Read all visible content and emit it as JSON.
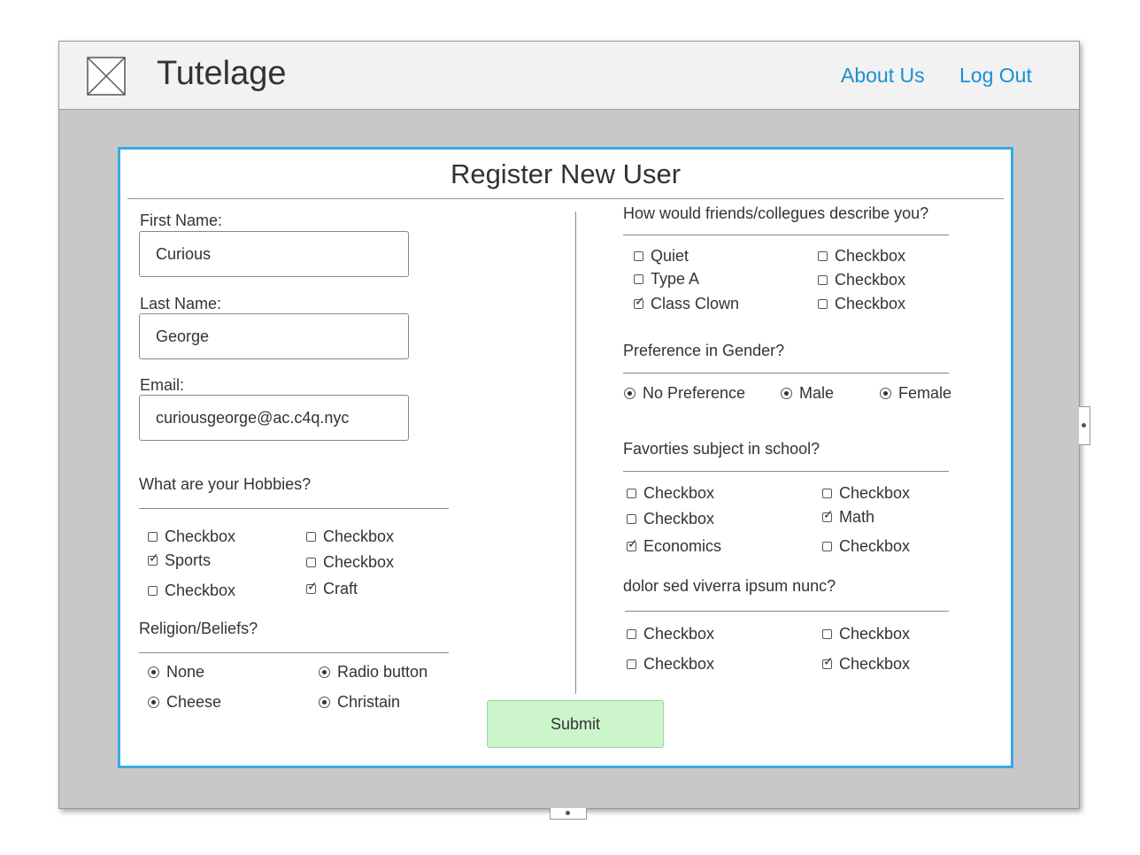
{
  "app": {
    "brand": "Tutelage"
  },
  "nav": {
    "about": "About Us",
    "logout": "Log Out"
  },
  "form": {
    "title": "Register New User",
    "first_name": {
      "label": "First Name:",
      "value": "Curious"
    },
    "last_name": {
      "label": "Last Name:",
      "value": "George"
    },
    "email": {
      "label": "Email:",
      "value": "curiousgeorge@ac.c4q.nyc"
    },
    "hobbies": {
      "question": "What are your Hobbies?",
      "options": [
        {
          "label": "Checkbox",
          "checked": false
        },
        {
          "label": "Checkbox",
          "checked": false
        },
        {
          "label": "Sports",
          "checked": true
        },
        {
          "label": "Checkbox",
          "checked": false
        },
        {
          "label": "Checkbox",
          "checked": false
        },
        {
          "label": "Craft",
          "checked": true
        }
      ]
    },
    "religion": {
      "question": "Religion/Beliefs?",
      "options": [
        {
          "label": "None",
          "selected": true
        },
        {
          "label": "Radio button",
          "selected": true
        },
        {
          "label": "Cheese",
          "selected": true
        },
        {
          "label": "Christain",
          "selected": true
        }
      ]
    },
    "friends": {
      "question": "How would friends/collegues describe you?",
      "options": [
        {
          "label": "Quiet",
          "checked": false
        },
        {
          "label": "Checkbox",
          "checked": false
        },
        {
          "label": "Type A",
          "checked": false
        },
        {
          "label": "Checkbox",
          "checked": false
        },
        {
          "label": "Class Clown",
          "checked": true
        },
        {
          "label": "Checkbox",
          "checked": false
        }
      ]
    },
    "gender": {
      "question": "Preference in Gender?",
      "options": [
        {
          "label": "No Preference",
          "selected": true
        },
        {
          "label": "Male",
          "selected": true
        },
        {
          "label": "Female",
          "selected": true
        }
      ]
    },
    "subject": {
      "question": "Favorties subject in school?",
      "options": [
        {
          "label": "Checkbox",
          "checked": false
        },
        {
          "label": "Checkbox",
          "checked": false
        },
        {
          "label": "Checkbox",
          "checked": false
        },
        {
          "label": "Math",
          "checked": true
        },
        {
          "label": "Economics",
          "checked": true
        },
        {
          "label": "Checkbox",
          "checked": false
        }
      ]
    },
    "lorem": {
      "question": "dolor sed viverra ipsum nunc?",
      "options": [
        {
          "label": "Checkbox",
          "checked": false
        },
        {
          "label": "Checkbox",
          "checked": false
        },
        {
          "label": "Checkbox",
          "checked": false
        },
        {
          "label": "Checkbox",
          "checked": true
        }
      ]
    },
    "submit_label": "Submit"
  },
  "colors": {
    "accent": "#3aa9e2",
    "link": "#1a8fd6",
    "submit_bg": "#ccf5cc",
    "frame_bg": "#c8c8c8"
  }
}
